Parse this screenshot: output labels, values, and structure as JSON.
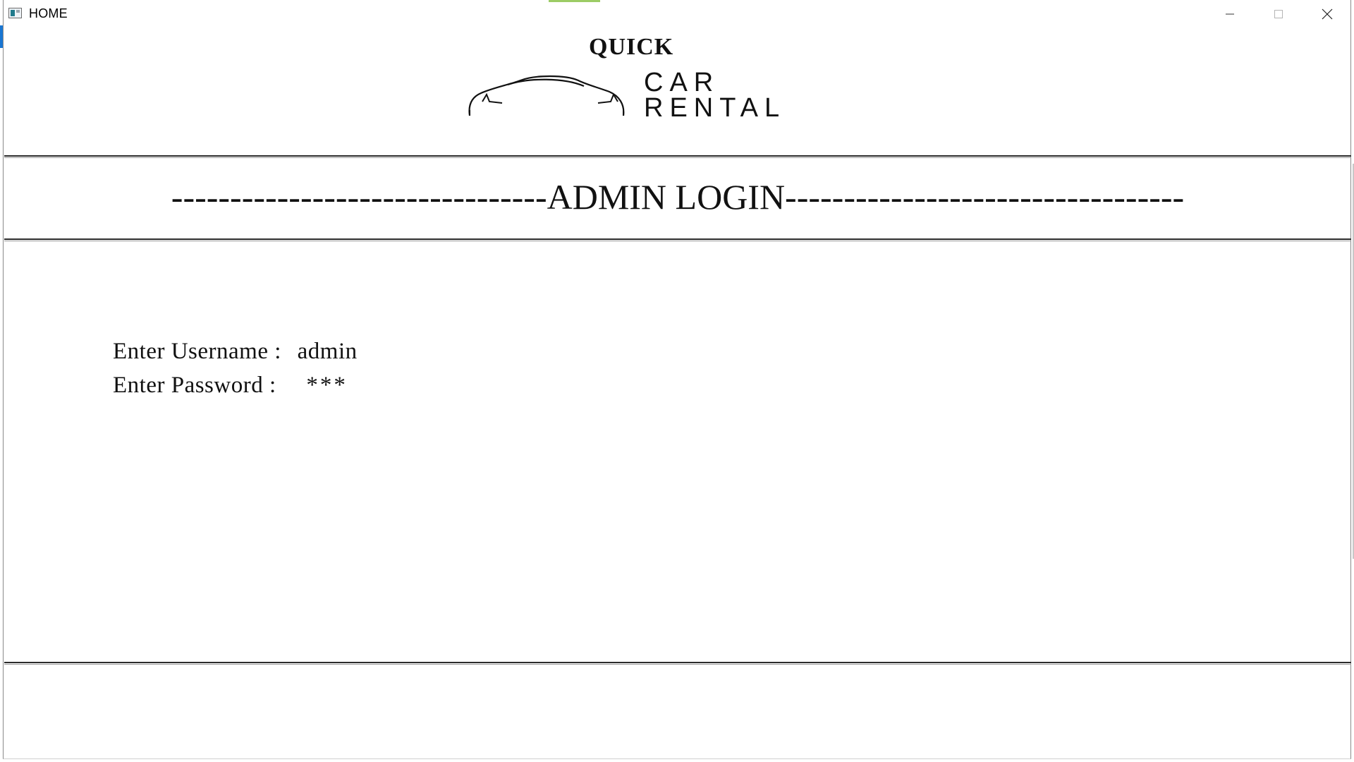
{
  "window": {
    "title": "HOME",
    "icon": "app-window-icon",
    "controls": {
      "minimize": "minimize-icon",
      "maximize": "maximize-icon",
      "close": "close-icon"
    }
  },
  "logo": {
    "line1": "QUICK",
    "line2": "CAR",
    "line3": "RENTAL",
    "graphic": "car-outline-icon"
  },
  "banner": {
    "text": "--------------------------------ADMIN LOGIN----------------------------------"
  },
  "form": {
    "username_label": "Enter Username :",
    "username_value": "admin",
    "password_label": "Enter Password :",
    "password_value": "***"
  },
  "colors": {
    "background": "#ffffff",
    "text": "#111111",
    "rule": "#2b2b2b",
    "accent_top": "#9ccc65",
    "desktop_strip": "#1976d2"
  }
}
